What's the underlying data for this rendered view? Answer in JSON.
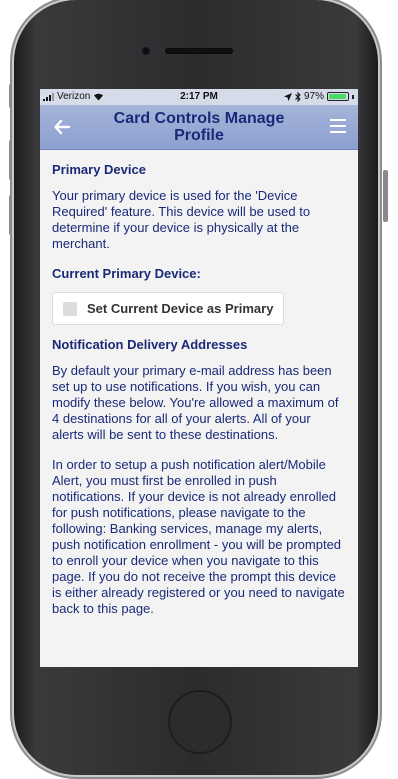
{
  "status_bar": {
    "carrier": "Verizon",
    "time": "2:17 PM",
    "battery": "97%",
    "battery_level": 0.97
  },
  "nav": {
    "title": "Card Controls Manage Profile"
  },
  "primary_device": {
    "heading": "Primary Device",
    "description": "Your primary device is used for the 'Device Required' feature. This device will be used to determine if your device is physically at the merchant.",
    "current_heading": "Current Primary Device:",
    "set_primary_label": "Set Current Device as Primary"
  },
  "notifications": {
    "heading": "Notification Delivery Addresses",
    "paragraph1": "By default your primary e-mail address has been set up to use notifications. If you wish, you can modify these below. You're allowed a maximum of 4 destinations for all of your alerts. All of your alerts will be sent to these destinations.",
    "paragraph2": "In order to setup a push notification alert/Mobile Alert, you must first be enrolled in push notifications. If your device is not already enrolled for push notifications, please navigate to the following: Banking services, manage my alerts, push notification enrollment - you will be prompted to enroll your device when you navigate to this page. If you do not receive the prompt this device is either already registered or you need to navigate back to this page."
  }
}
